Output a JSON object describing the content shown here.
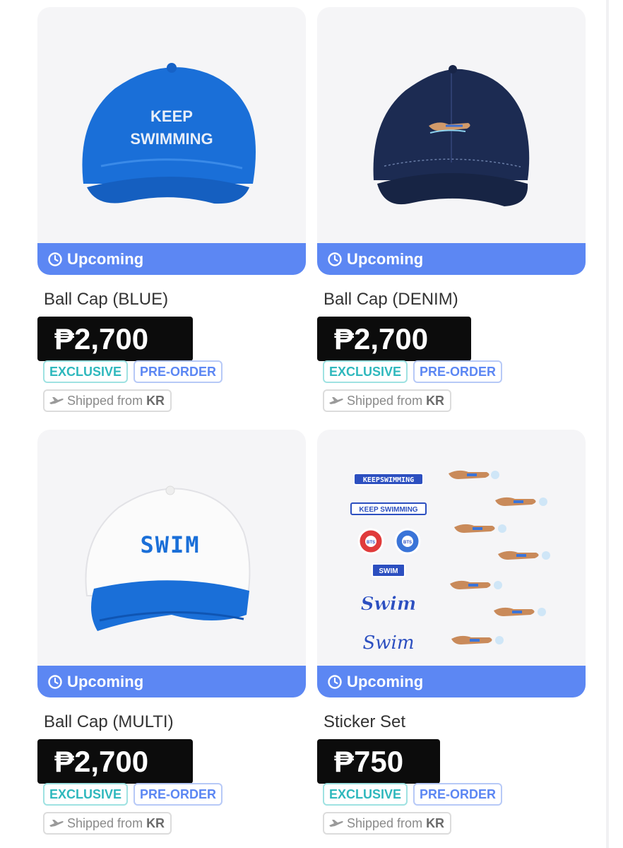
{
  "products": [
    {
      "name": "Ball Cap (BLUE)",
      "price": "₱2,700",
      "status": "Upcoming",
      "tags": [
        "EXCLUSIVE",
        "PRE-ORDER"
      ],
      "shipping_label": "Shipped from",
      "shipping_origin": "KR",
      "image_text": [
        "KEEP",
        "SWIMMING"
      ]
    },
    {
      "name": "Ball Cap (DENIM)",
      "price": "₱2,700",
      "status": "Upcoming",
      "tags": [
        "EXCLUSIVE",
        "PRE-ORDER"
      ],
      "shipping_label": "Shipped from",
      "shipping_origin": "KR"
    },
    {
      "name": "Ball Cap (MULTI)",
      "price": "₱2,700",
      "status": "Upcoming",
      "tags": [
        "EXCLUSIVE",
        "PRE-ORDER"
      ],
      "shipping_label": "Shipped from",
      "shipping_origin": "KR",
      "image_text": [
        "SWIM"
      ]
    },
    {
      "name": "Sticker Set",
      "price": "₱750",
      "status": "Upcoming",
      "tags": [
        "EXCLUSIVE",
        "PRE-ORDER"
      ],
      "shipping_label": "Shipped from",
      "shipping_origin": "KR",
      "image_text": [
        "KEEPSWIMMING",
        "KEEP SWIMMING",
        "BTS",
        "BTS",
        "SWIM",
        "Swim",
        "Swim"
      ]
    }
  ],
  "colors": {
    "status_bar": "#5c87f3",
    "price_bg": "#0c0c0c",
    "exclusive": "#2fb8bd",
    "preorder": "#5c87f3",
    "cap_blue": "#1a6fd8",
    "cap_denim": "#1c2b52"
  },
  "icons": {
    "status": "clock-icon",
    "shipping": "airplane-icon"
  }
}
